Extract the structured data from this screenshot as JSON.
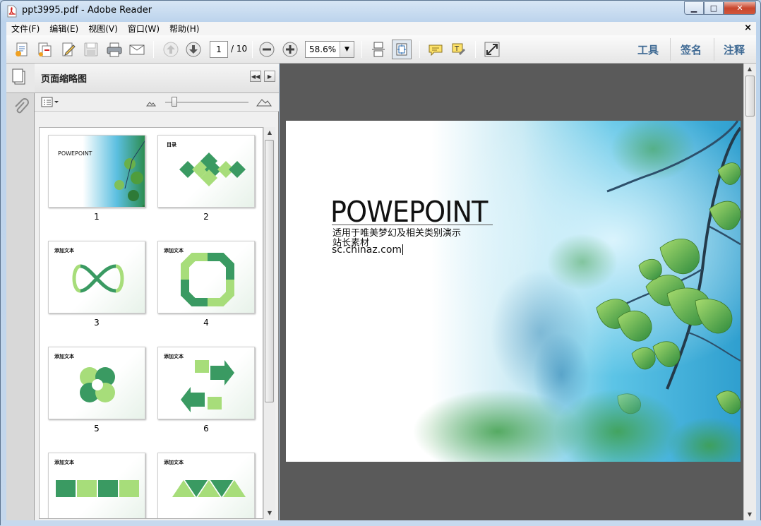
{
  "window": {
    "title": "ppt3995.pdf - Adobe Reader",
    "minimize": "▁",
    "maximize": "□",
    "close": "✕"
  },
  "menu": {
    "items": [
      "文件(F)",
      "编辑(E)",
      "视图(V)",
      "窗口(W)",
      "帮助(H)"
    ],
    "close": "×"
  },
  "toolbar": {
    "page_current": "1",
    "page_total": "/ 10",
    "zoom": "58.6%",
    "zoom_dropdown": "▼",
    "right_tools": [
      "工具",
      "签名",
      "注释"
    ]
  },
  "panel": {
    "title": "页面缩略图",
    "collapse": "◀◀",
    "expand": "▶"
  },
  "thumbnails": [
    {
      "num": "1",
      "heading": "POWEPOINT"
    },
    {
      "num": "2",
      "heading": "目录"
    },
    {
      "num": "3",
      "heading": "添加文本"
    },
    {
      "num": "4",
      "heading": "添加文本"
    },
    {
      "num": "5",
      "heading": "添加文本"
    },
    {
      "num": "6",
      "heading": "添加文本"
    },
    {
      "num": "",
      "heading": "添加文本"
    },
    {
      "num": "",
      "heading": "添加文本"
    }
  ],
  "slide": {
    "title": "POWEPOINT",
    "subtitle": "适用于唯美梦幻及相关类别演示",
    "subtitle2": "站长素材",
    "url": "sc.chinaz.com"
  },
  "colors": {
    "accent": "#3f6a94",
    "doc_bg": "#5a5a5a",
    "leaf_green": "#3f9a4a",
    "sky": "#3fb4d8"
  }
}
